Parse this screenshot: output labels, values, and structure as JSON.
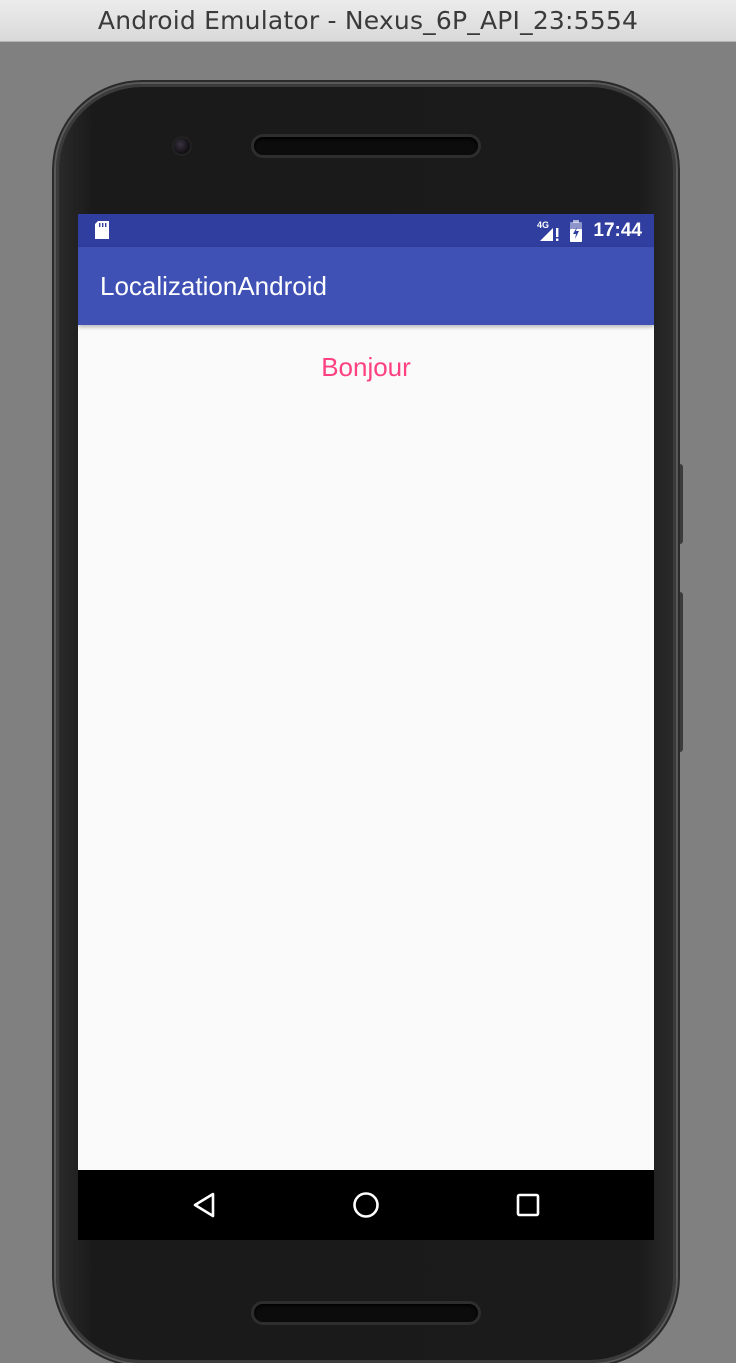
{
  "window": {
    "title": "Android Emulator - Nexus_6P_API_23:5554"
  },
  "status_bar": {
    "left_icon": "sd-card-icon",
    "network_label": "4G",
    "signal_icon": "signal-no-data-icon",
    "battery_icon": "battery-charging-icon",
    "time": "17:44"
  },
  "app_bar": {
    "title": "LocalizationAndroid"
  },
  "content": {
    "greeting": "Bonjour"
  },
  "nav_bar": {
    "back_icon": "back-triangle-icon",
    "home_icon": "home-circle-icon",
    "recents_icon": "recents-square-icon"
  },
  "colors": {
    "status_bar": "#303f9f",
    "app_bar": "#3f51b5",
    "accent_text": "#ff4081",
    "background": "#fafafa"
  }
}
